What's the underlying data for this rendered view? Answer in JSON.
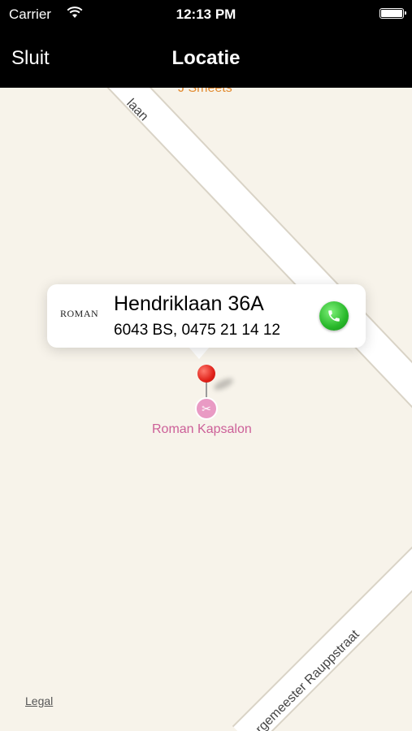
{
  "status_bar": {
    "carrier": "Carrier",
    "time": "12:13 PM",
    "wifi_icon": "wifi-icon",
    "battery_icon": "battery-icon"
  },
  "nav": {
    "left_button": "Sluit",
    "title": "Locatie"
  },
  "map": {
    "poi_top_label": "J Smeets",
    "road_top_label": "laan",
    "road_bottom_label": "rgemeester Rauppstraat",
    "pin_color": "#e0221a",
    "poi": {
      "icon": "hair-salon-icon",
      "label": "Roman Kapsalon",
      "color": "#e99ac4"
    },
    "legal_link": "Legal"
  },
  "callout": {
    "logo_text": "ROMAN",
    "title": "Hendriklaan 36A",
    "subtitle": "6043 BS, 0475 21 14 12",
    "phone_icon": "phone-icon",
    "phone_button_color": "#28b82a"
  }
}
